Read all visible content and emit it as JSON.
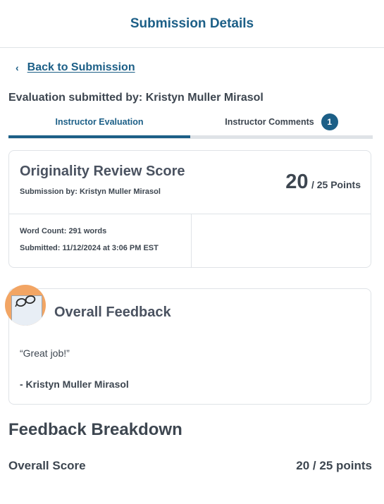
{
  "header": {
    "title": "Submission Details"
  },
  "back_link": {
    "chevron": "‹",
    "label": "Back to Submission"
  },
  "evaluation": {
    "submitted_by": "Evaluation submitted by: Kristyn Muller Mirasol"
  },
  "tabs": [
    {
      "label": "Instructor Evaluation",
      "active": true
    },
    {
      "label": "Instructor Comments",
      "badge": "1",
      "active": false
    }
  ],
  "score_card": {
    "title": "Originality Review Score",
    "subtitle": "Submission by: Kristyn Muller Mirasol",
    "score": "20",
    "points_suffix": "/ 25 Points",
    "word_count": "Word Count: 291 words",
    "submitted": "Submitted: 11/12/2024 at 3:06 PM EST"
  },
  "feedback": {
    "title": "Overall Feedback",
    "quote": "“Great job!”",
    "author": "- Kristyn Muller Mirasol",
    "avatar_icon": "glasses-icon"
  },
  "breakdown": {
    "title": "Feedback Breakdown",
    "overall_label": "Overall Score",
    "overall_value": "20 / 25 points"
  },
  "colors": {
    "primary": "#1c5f87",
    "text": "#3d4650",
    "border": "#dfe3e7",
    "avatar_bg": "#f2a564"
  }
}
